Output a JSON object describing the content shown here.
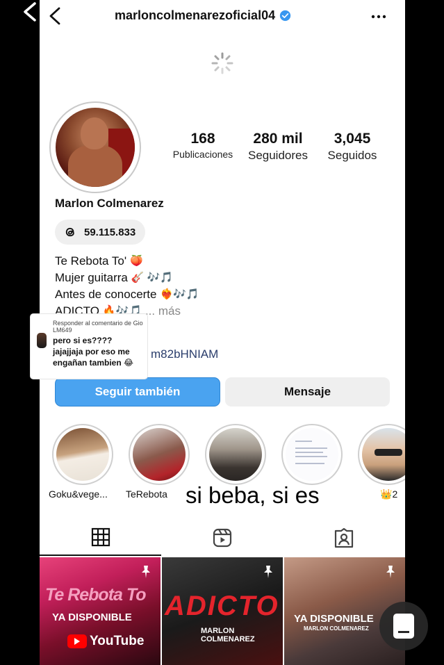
{
  "header": {
    "username": "marloncolmenarezoficial04",
    "verified": true,
    "icons": [
      "back-arrow-icon",
      "verified-badge-icon",
      "more-options-icon",
      "loading-spinner-icon"
    ]
  },
  "profile": {
    "display_name": "Marlon Colmenarez",
    "stats": [
      {
        "value": "168",
        "label": "Publicaciones"
      },
      {
        "value": "280 mil",
        "label": "Seguidores"
      },
      {
        "value": "3,045",
        "label": "Seguidos"
      }
    ],
    "threads_count": "59.115.833",
    "bio": [
      {
        "text": "Te Rebota To'",
        "emoji": "🍑"
      },
      {
        "text": "Mujer guitarra",
        "emoji": "🎸 🎶🎵"
      },
      {
        "text": "Antes de conocerte",
        "emoji": "❤️‍🔥🎶🎵"
      },
      {
        "text": "ADICTO",
        "emoji": "🔥🎶🎵"
      }
    ],
    "bio_more": "... más",
    "link_fragment": "m82bHNIAM"
  },
  "buttons": {
    "follow": "Seguir también",
    "message": "Mensaje"
  },
  "highlights": [
    {
      "label": "Goku&vege..."
    },
    {
      "label": "TeRebota"
    },
    {
      "label": ""
    },
    {
      "label": ""
    },
    {
      "label": "2",
      "emoji": "👑"
    }
  ],
  "overlay_caption": "si beba, si es",
  "comment_popup": {
    "title": "Responder al comentario de Gio LM649",
    "body": "pero si es????\njajajjaja por eso me engañan tambien 😂"
  },
  "tabs": [
    "grid-tab",
    "reels-tab",
    "tagged-tab"
  ],
  "posts": [
    {
      "title": "Te Rebota To",
      "subtitle": "YA DISPONIBLE",
      "badge": "YouTube",
      "pinned": true
    },
    {
      "title": "ADICTO",
      "subtitle": "MARLON COLMENAREZ",
      "pinned": true
    },
    {
      "title": "YA DISPONIBLE",
      "subtitle": "MARLON COLMENAREZ",
      "pinned": true
    }
  ],
  "colors": {
    "follow_button": "#4aa3f0",
    "verified_badge": "#3897f0",
    "message_button": "#efefef"
  }
}
